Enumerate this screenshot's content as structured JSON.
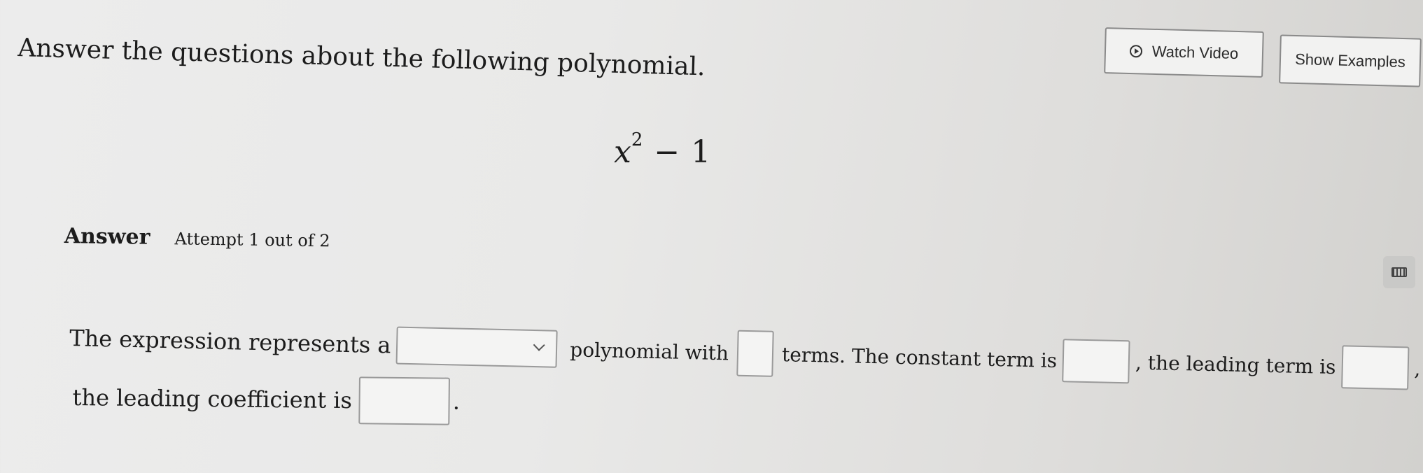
{
  "question": {
    "text": "Answer the questions about the following polynomial."
  },
  "polynomial": {
    "variable": "x",
    "exponent": "2",
    "operator": "−",
    "constant": "1"
  },
  "buttons": {
    "watch_video": "Watch Video",
    "show_examples": "Show Examples"
  },
  "answer": {
    "label": "Answer",
    "attempt": "Attempt 1 out of 2"
  },
  "sentence": {
    "part1": "The expression represents a",
    "part2": "polynomial with",
    "part3": "terms. The constant term is",
    "part4": ", the leading term is",
    "part5": ", and",
    "part6": "the leading coefficient is",
    "part7": "."
  },
  "inputs": {
    "polynomial_type": "",
    "num_terms": "",
    "constant_term": "",
    "leading_term": "",
    "leading_coefficient": ""
  },
  "icons": {
    "play": "play-circle-icon",
    "keyboard": "keyboard-icon",
    "dropdown": "chevron-down-icon"
  }
}
